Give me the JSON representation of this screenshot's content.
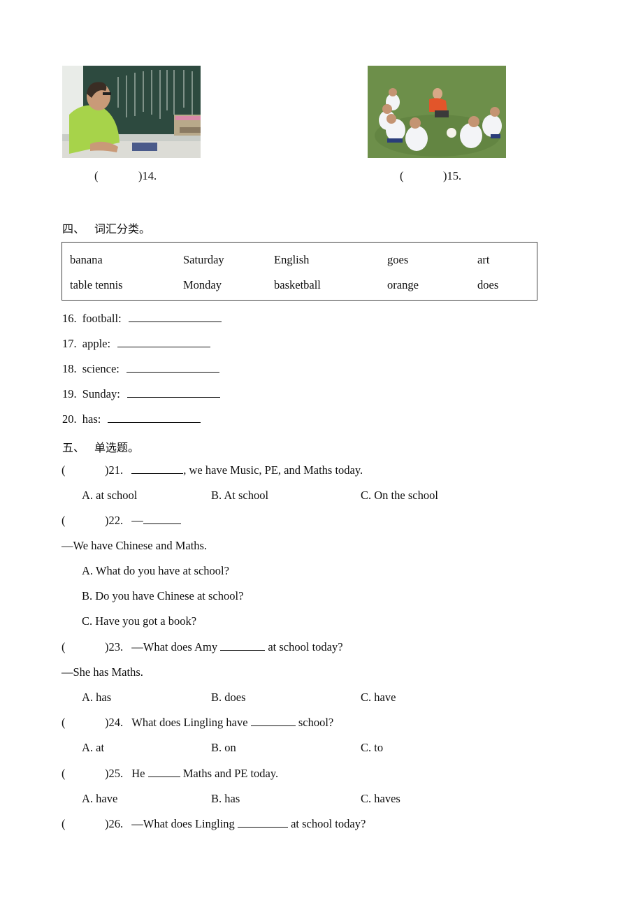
{
  "picture_items": [
    {
      "number": "14",
      "paren_open": "(",
      "paren_close": ")",
      "label": ")14.",
      "image": "man-looking-at-chalkboard-photo"
    },
    {
      "number": "15",
      "paren_open": "(",
      "paren_close": ")",
      "label": ")15.",
      "image": "coach-with-kids-on-football-field-photo"
    }
  ],
  "section4": {
    "title_num": "四、",
    "title": "词汇分类。",
    "words": [
      [
        "banana",
        "Saturday",
        "English",
        "goes",
        "art"
      ],
      [
        "table tennis",
        "Monday",
        "basketball",
        "orange",
        "does"
      ]
    ],
    "items": [
      {
        "num": "16.",
        "word": "football:"
      },
      {
        "num": "17.",
        "word": "apple:"
      },
      {
        "num": "18.",
        "word": "science:"
      },
      {
        "num": "19.",
        "word": "Sunday:"
      },
      {
        "num": "20.",
        "word": "has:"
      }
    ]
  },
  "section5": {
    "title_num": "五、",
    "title": "单选题。",
    "questions": [
      {
        "paren": "(",
        "num": ")21.",
        "pre": "",
        "post": ", we have Music, PE, and Maths today.",
        "options": [
          "A.  at school",
          "B.  At school",
          "C.  On the school"
        ]
      },
      {
        "paren": "(",
        "num": ")22.",
        "pre": "—",
        "post": "",
        "answer_line": "—We have Chinese and Maths.",
        "options": [
          "A.  What do you have at school?",
          "B.  Do you have Chinese at school?",
          "C.  Have you got a book?"
        ]
      },
      {
        "paren": "(",
        "num": ")23.",
        "pre": "—What does Amy ",
        "post": " at school today?",
        "answer_line": "—She has Maths.",
        "options": [
          "A.  has",
          "B.  does",
          "C.  have"
        ]
      },
      {
        "paren": "(",
        "num": ")24.",
        "pre": "What does Lingling have ",
        "post": " school?",
        "options": [
          "A.  at",
          "B.  on",
          "C.  to"
        ]
      },
      {
        "paren": "(",
        "num": ")25.",
        "pre": "He ",
        "post": " Maths and PE today.",
        "options": [
          "A.  have",
          "B.  has",
          "C.  haves"
        ]
      },
      {
        "paren": "(",
        "num": ")26.",
        "pre": "—What does Lingling ",
        "post": " at school today?"
      }
    ]
  }
}
